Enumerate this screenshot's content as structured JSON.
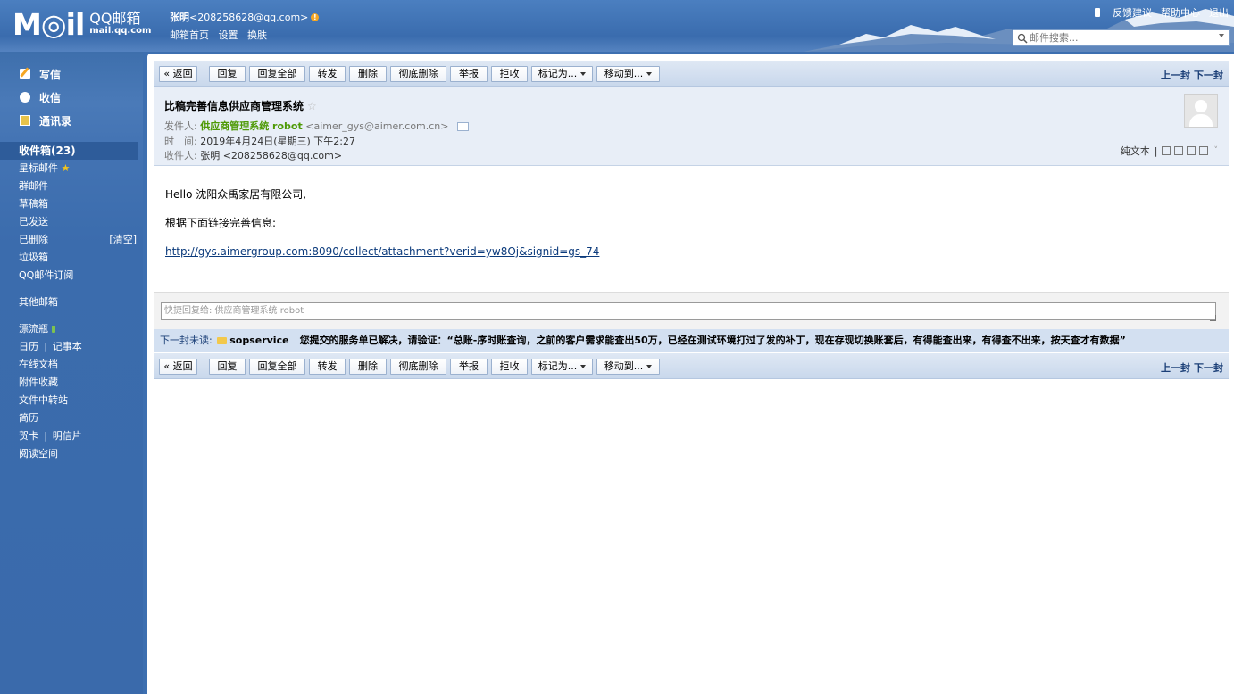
{
  "header": {
    "logo_text": "M◎il",
    "logo_cn": "QQ邮箱",
    "logo_domain": "mail.qq.com",
    "user_name": "张明",
    "user_email": "<208258628@qq.com>",
    "links": [
      "邮箱首页",
      "设置",
      "换肤"
    ],
    "top_links": [
      "反馈建议",
      "帮助中心",
      "退出"
    ],
    "search_placeholder": "邮件搜索..."
  },
  "sidebar": {
    "top": [
      {
        "label": "写信",
        "icon": "write-icon"
      },
      {
        "label": "收信",
        "icon": "receive-icon"
      },
      {
        "label": "通讯录",
        "icon": "contacts-icon"
      }
    ],
    "inbox": "收件箱(23)",
    "starred": "星标邮件",
    "group": "群邮件",
    "drafts": "草稿箱",
    "sent": "已发送",
    "deleted": "已删除",
    "clear": "[清空]",
    "spam": "垃圾箱",
    "subscribe": "QQ邮件订阅",
    "other": "其他邮箱",
    "drift": "漂流瓶",
    "calendar": "日历",
    "notes": "记事本",
    "docs": "在线文档",
    "attachments": "附件收藏",
    "transfer": "文件中转站",
    "resume": "简历",
    "cards": "贺卡",
    "postcards": "明信片",
    "reading": "阅读空间"
  },
  "toolbar": {
    "back": "« 返回",
    "reply": "回复",
    "reply_all": "回复全部",
    "forward": "转发",
    "delete": "删除",
    "perm_delete": "彻底删除",
    "report": "举报",
    "reject": "拒收",
    "mark_as": "标记为...",
    "move_to": "移动到...",
    "prev": "上一封",
    "next": "下一封"
  },
  "mail": {
    "subject": "比稿完善信息供应商管理系统",
    "from_label": "发件人:",
    "from_name": "供应商管理系统 robot",
    "from_addr": "<aimer_gys@aimer.com.cn>",
    "time_label": "时　间:",
    "time": "2019年4月24日(星期三) 下午2:27",
    "to_label": "收件人:",
    "to": "张明 <208258628@qq.com>",
    "plain_text": "纯文本",
    "greeting": "Hello 沈阳众禹家居有限公司,",
    "line2": "根据下面链接完善信息:",
    "link": "http://gys.aimergroup.com:8090/collect/attachment?verid=yw8Oj&signid=gs_74"
  },
  "quick_reply": {
    "placeholder": "快捷回复给: 供应商管理系统 robot"
  },
  "next_unread": {
    "label": "下一封未读:",
    "from": "sopservice",
    "subject": "您提交的服务单已解决，请验证：“总账-序时账查询，之前的客户需求能查出50万，已经在测试环境打过了发的补丁，现在存现切换账套后，有得能查出来，有得查不出来，按天查才有数据”"
  },
  "colors": {
    "header_blue": "#3a6cae",
    "sender_green": "#4e9a06",
    "link_blue": "#0c3b7c"
  }
}
